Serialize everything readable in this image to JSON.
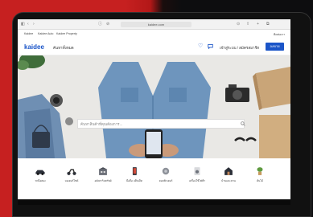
{
  "browser": {
    "url": "kaidee.com",
    "controls_left": [
      "◧",
      "‹",
      "›"
    ],
    "controls_mid": [
      "ⓘ",
      "⊘"
    ],
    "controls_right": [
      "⊙",
      "⇧",
      "+",
      "⧉"
    ]
  },
  "top_links": {
    "items": [
      "Kaidee",
      "Kaidee Auto",
      "Kaidee Property"
    ],
    "right": "ติดต่อเรา"
  },
  "header": {
    "logo": "kaidee",
    "search_label": "ค้นหาทั้งหมด",
    "login_label": "เข้าสู่ระบบ / สมัครสมาชิก",
    "post_button": "ลงขาย"
  },
  "hero": {
    "search_placeholder": "ค้นหาสินค้าที่คุณต้องการ..."
  },
  "categories": [
    {
      "label": "รถมือสอง",
      "icon": "car-icon"
    },
    {
      "label": "มอเตอร์ไซค์",
      "icon": "motorcycle-icon"
    },
    {
      "label": "อสังหาริมทรัพย์",
      "icon": "building-icon"
    },
    {
      "label": "มือถือ แท็บเล็ต",
      "icon": "phone-icon"
    },
    {
      "label": "คอมพิวเตอร์",
      "icon": "computer-icon"
    },
    {
      "label": "เครื่องใช้ไฟฟ้า",
      "icon": "appliance-icon"
    },
    {
      "label": "บ้านและสวน",
      "icon": "house-icon"
    },
    {
      "label": "ต้นไม้",
      "icon": "plant-icon"
    }
  ],
  "colors": {
    "brand": "#1b55c8",
    "background_red": "#c62020"
  }
}
